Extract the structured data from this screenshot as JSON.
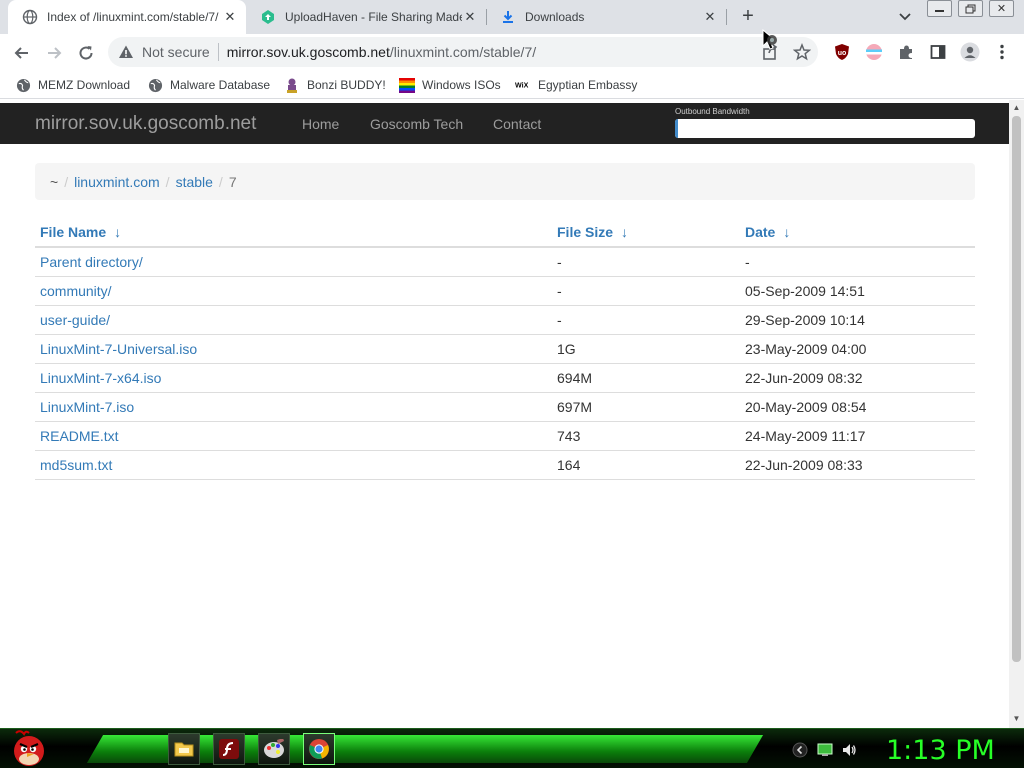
{
  "tabs": [
    {
      "title": "Index of /linuxmint.com/stable/7/",
      "active": true,
      "icon": "globe-icon"
    },
    {
      "title": "UploadHaven - File Sharing Made Simple",
      "active": false,
      "icon": "uploadhaven-icon"
    },
    {
      "title": "Downloads",
      "active": false,
      "icon": "download-icon"
    }
  ],
  "toolbar": {
    "security_label": "Not secure",
    "url_host": "mirror.sov.uk.goscomb.net",
    "url_path": "/linuxmint.com/stable/7/"
  },
  "bookmarks": [
    {
      "label": "MEMZ Download",
      "icon": "globe-icon"
    },
    {
      "label": "Malware Database",
      "icon": "globe-icon"
    },
    {
      "label": "Bonzi BUDDY!",
      "icon": "bonzi-icon"
    },
    {
      "label": "Windows ISOs",
      "icon": "windows-flag-icon"
    },
    {
      "label": "Egyptian Embassy",
      "icon": "wix-icon"
    }
  ],
  "site": {
    "brand": "mirror.sov.uk.goscomb.net",
    "nav": [
      "Home",
      "Goscomb Tech",
      "Contact"
    ],
    "bandwidth_label": "Outbound Bandwidth",
    "bandwidth_fraction": 0.01
  },
  "breadcrumb": {
    "home": "~",
    "links": [
      "linuxmint.com",
      "stable"
    ],
    "current": "7",
    "separator": "/"
  },
  "table": {
    "headers": [
      "File Name",
      "File Size",
      "Date"
    ],
    "sort_arrow": "↓",
    "rows": [
      {
        "name": "Parent directory/",
        "size": "-",
        "date": "-"
      },
      {
        "name": "community/",
        "size": "-",
        "date": "05-Sep-2009 14:51"
      },
      {
        "name": "user-guide/",
        "size": "-",
        "date": "29-Sep-2009 10:14"
      },
      {
        "name": "LinuxMint-7-Universal.iso",
        "size": "1G",
        "date": "23-May-2009 04:00"
      },
      {
        "name": "LinuxMint-7-x64.iso",
        "size": "694M",
        "date": "22-Jun-2009 08:32"
      },
      {
        "name": "LinuxMint-7.iso",
        "size": "697M",
        "date": "20-May-2009 08:54"
      },
      {
        "name": "README.txt",
        "size": "743",
        "date": "24-May-2009 11:17"
      },
      {
        "name": "md5sum.txt",
        "size": "164",
        "date": "22-Jun-2009 08:33"
      }
    ]
  },
  "taskbar": {
    "clock": "1:13 PM",
    "apps": [
      "file-explorer-icon",
      "flash-icon",
      "paint-icon",
      "chrome-icon"
    ]
  },
  "colors": {
    "link": "#337ab7",
    "navbar": "#222222",
    "clock": "#27ff27"
  }
}
